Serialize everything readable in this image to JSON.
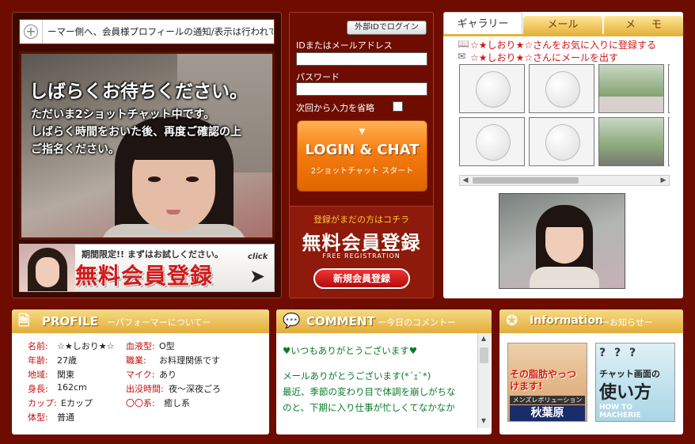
{
  "ticker": {
    "text": "ーマー側へ、会員様プロフィールの通知/表示は行われており"
  },
  "video": {
    "wait_title": "しばらくお待ちください。",
    "wait_lines": [
      "ただいま2ショットチャット中です。",
      "しばらく時間をおいた後、再度ご確認の上",
      "ご指名ください。"
    ]
  },
  "trial_banner": {
    "small": "期間限定!! まずはお試しください。",
    "big": "無料会員登録",
    "click": "click"
  },
  "login": {
    "external_login": "外部IDでログイン",
    "id_label": "IDまたはメールアドレス",
    "password_label": "パスワード",
    "remember_label": "次回から入力を省略",
    "login_button_arrow": "▼",
    "login_button_main": "LOGIN & CHAT",
    "login_button_sub": "2ショットチャット スタート",
    "reg_notice": "登録がまだの方はコチラ",
    "reg_title": "無料会員登録",
    "reg_sub": "FREE REGISTRATION",
    "new_reg_button": "新規会員登録"
  },
  "gallery": {
    "tabs": [
      "ギャラリー",
      "メール",
      "メモ"
    ],
    "fav_line": "☆★しおり★☆さんをお気に入りに登録する",
    "mail_line": "☆★しおり★☆さんにメールを出す"
  },
  "profile": {
    "title": "PROFILE",
    "subtitle": "ーパフォーマーについてー",
    "left": [
      {
        "k": "名前:",
        "v": "☆★しおり★☆"
      },
      {
        "k": "年齢:",
        "v": "27歳"
      },
      {
        "k": "地域:",
        "v": "関東"
      },
      {
        "k": "身長:",
        "v": "162cm"
      },
      {
        "k": "カップ:",
        "v": "Eカップ"
      },
      {
        "k": "体型:",
        "v": "普通"
      }
    ],
    "right": [
      {
        "k": "血液型:",
        "v": "O型"
      },
      {
        "k": "職業:",
        "v": "お料理関係です"
      },
      {
        "k": "マイク:",
        "v": "あり"
      },
      {
        "k": "出没時間:",
        "v": "夜〜深夜ごろ"
      },
      {
        "k": "〇〇系:",
        "v": "癒し系"
      }
    ]
  },
  "comment": {
    "title": "COMMENT",
    "subtitle": "ー今日のコメントー",
    "lines": [
      "♥いつもありがとうございます♥",
      "",
      "メールありがとうございます(*´ｪ`*)",
      "最近、季節の変わり目で体調を崩しがちな",
      "のと、下期に入り仕事が忙しくてなかなか"
    ]
  },
  "info": {
    "title": "Information",
    "subtitle": "ーお知らせー",
    "ad_diet": {
      "headline": "その脂肪やっつけます!",
      "caption": "メンズレボリューション",
      "place": "秋葉原"
    },
    "ad_help": {
      "q": "? ? ?",
      "line1": "チャット画面の",
      "line2": "使い方",
      "small": "HOW TO MACHERIE"
    }
  }
}
